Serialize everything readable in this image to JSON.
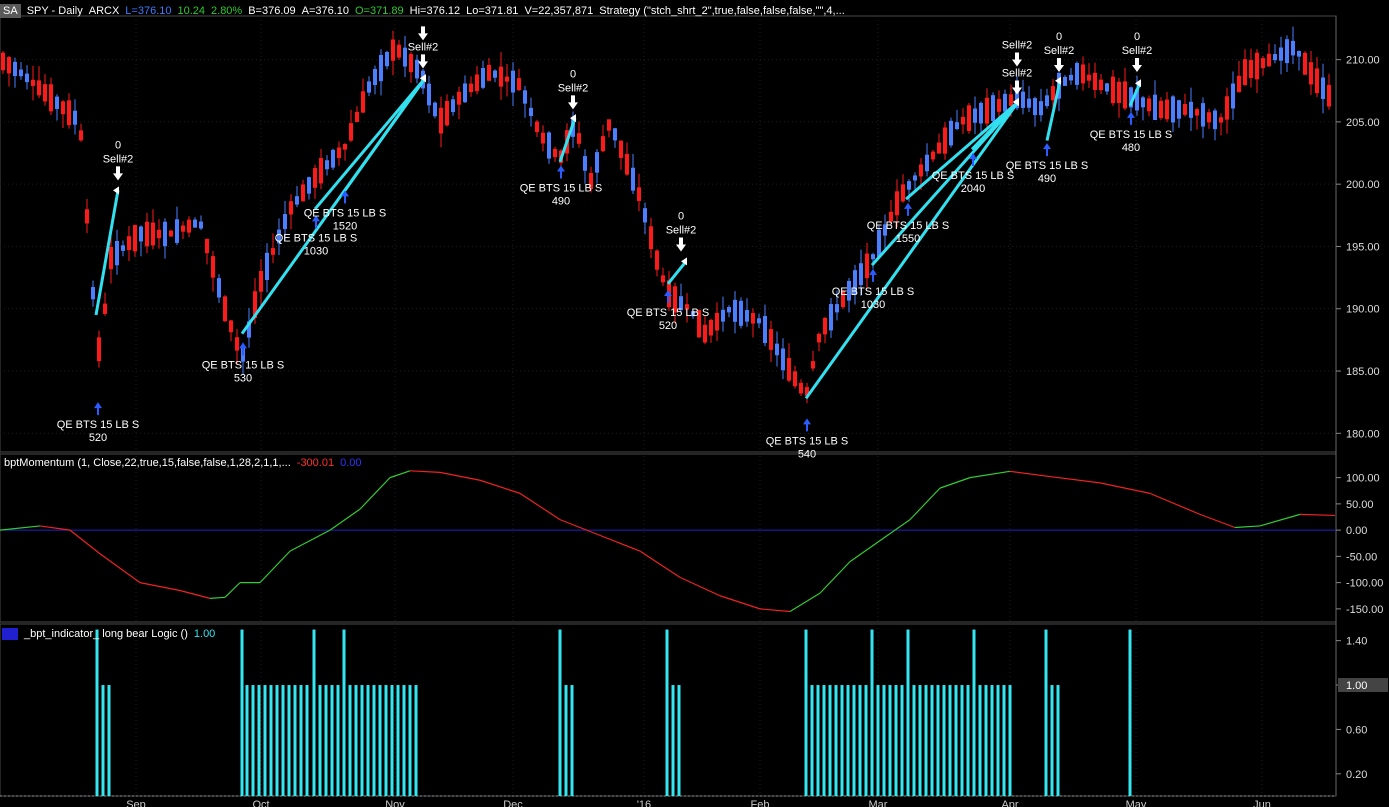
{
  "header": {
    "symbol_badge": "SA",
    "symbol": "SPY - Daily",
    "exchange": "ARCX",
    "last": "L=376.10",
    "change": "10.24",
    "change_pct": "2.80%",
    "bid": "B=376.09",
    "ask": "A=376.10",
    "open": "O=371.89",
    "high": "Hi=376.12",
    "low": "Lo=371.81",
    "volume": "V=22,357,871",
    "strategy": "Strategy (\"stch_shrt_2\",true,false,false,false,\"\",4,..."
  },
  "momentum_header": {
    "name": "bptMomentum (1, Close,22,true,15,false,false,1,28,2,1,1,...",
    "value1": "-300.01",
    "value2": "0.00"
  },
  "indicator_header": {
    "name": "_bpt_indicator_ long bear Logic ()",
    "value": "1.00"
  },
  "colors": {
    "up": "#4a7fff",
    "down": "#ff1a1a",
    "trend_line": "#33e0f0",
    "momentum_up": "#33cc33",
    "momentum_down": "#ee2222",
    "zero_line": "#2222cc",
    "bars": "#33e6f0",
    "grid": "#1e1e1e"
  },
  "chart_data": {
    "type": "candlestick",
    "price_axis": {
      "ticks": [
        "210.00",
        "205.00",
        "200.00",
        "195.00",
        "190.00",
        "185.00",
        "180.00"
      ],
      "range": [
        178.5,
        213.5
      ]
    },
    "momentum_axis": {
      "ticks": [
        "100.00",
        "50.00",
        "0.00",
        "-50.00",
        "-100.00",
        "-150.00"
      ],
      "range": [
        -175,
        145
      ]
    },
    "indicator_axis": {
      "ticks": [
        "1.40",
        "1.00",
        "0.60",
        "0.20"
      ],
      "highlight": "1.00",
      "range": [
        0,
        1.55
      ]
    },
    "x_ticks": [
      "Sep",
      "Oct",
      "Nov",
      "Dec",
      "'16",
      "Feb",
      "Mar",
      "Apr",
      "May",
      "Jun"
    ],
    "trade_lines": [
      {
        "points": [
          [
            96,
            189.5
          ],
          [
            118,
            199.5
          ]
        ]
      },
      {
        "points": [
          [
            242,
            188.0
          ],
          [
            425,
            208.5
          ]
        ]
      },
      {
        "points": [
          [
            315,
            198.0
          ],
          [
            425,
            208.5
          ]
        ]
      },
      {
        "points": [
          [
            345,
            199.5
          ],
          [
            425,
            208.5
          ]
        ]
      },
      {
        "points": [
          [
            560,
            201.8
          ],
          [
            575,
            205.3
          ]
        ]
      },
      {
        "points": [
          [
            668,
            192.0
          ],
          [
            686,
            193.8
          ]
        ]
      },
      {
        "points": [
          [
            806,
            182.8
          ],
          [
            1018,
            206.6
          ]
        ]
      },
      {
        "points": [
          [
            872,
            193.5
          ],
          [
            1018,
            206.6
          ]
        ]
      },
      {
        "points": [
          [
            906,
            198.8
          ],
          [
            1018,
            206.6
          ]
        ]
      },
      {
        "points": [
          [
            972,
            202.8
          ],
          [
            1018,
            206.6
          ]
        ]
      },
      {
        "points": [
          [
            1047,
            203.5
          ],
          [
            1060,
            208.3
          ]
        ]
      },
      {
        "points": [
          [
            1130,
            206.3
          ],
          [
            1140,
            208.1
          ]
        ]
      }
    ],
    "buy_labels": [
      {
        "x": 98,
        "price": 182.5,
        "text": "QE BTS 15 LB S",
        "qty": "520"
      },
      {
        "x": 243,
        "price": 187.3,
        "text": "QE BTS 15 LB S",
        "qty": "530"
      },
      {
        "x": 316,
        "price": 197.5,
        "text": "QE BTS 15 LB S",
        "qty": "1030"
      },
      {
        "x": 345,
        "price": 199.5,
        "text": "QE BTS 15 LB S",
        "qty": "1520"
      },
      {
        "x": 561,
        "price": 201.5,
        "text": "QE BTS 15 LB S",
        "qty": "490"
      },
      {
        "x": 668,
        "price": 191.5,
        "text": "QE BTS 15 LB S",
        "qty": "520"
      },
      {
        "x": 807,
        "price": 181.2,
        "text": "QE BTS 15 LB S",
        "qty": "540"
      },
      {
        "x": 873,
        "price": 193.2,
        "text": "QE BTS 15 LB S",
        "qty": "1030"
      },
      {
        "x": 908,
        "price": 198.5,
        "text": "QE BTS 15 LB S",
        "qty": "1550"
      },
      {
        "x": 973,
        "price": 202.5,
        "text": "QE BTS 15 LB S",
        "qty": "2040"
      },
      {
        "x": 1047,
        "price": 203.3,
        "text": "QE BTS 15 LB S",
        "qty": "490"
      },
      {
        "x": 1131,
        "price": 205.8,
        "text": "QE BTS 15 LB S",
        "qty": "480"
      }
    ],
    "sell_labels": [
      {
        "x": 118,
        "price": 200.3,
        "top": "0",
        "text": "Sell#2"
      },
      {
        "x": 423,
        "price": 209.3,
        "top": "",
        "text": "Sell#2"
      },
      {
        "x": 423,
        "price": 209.3,
        "top": "",
        "text": ""
      },
      {
        "x": 573,
        "price": 206.0,
        "top": "0",
        "text": "Sell#2"
      },
      {
        "x": 681,
        "price": 194.6,
        "top": "0",
        "text": "Sell#2"
      },
      {
        "x": 1017,
        "price": 207.2,
        "top": "",
        "text": "Sell#2"
      },
      {
        "x": 1017,
        "price": 207.2,
        "top": "",
        "text": "Sell#2"
      },
      {
        "x": 1059,
        "price": 209.0,
        "top": "0",
        "text": "Sell#2"
      },
      {
        "x": 1137,
        "price": 209.0,
        "top": "0",
        "text": "Sell#2"
      }
    ],
    "momentum_points": [
      [
        0,
        0
      ],
      [
        40,
        8
      ],
      [
        70,
        0
      ],
      [
        100,
        -45
      ],
      [
        140,
        -100
      ],
      [
        180,
        -115
      ],
      [
        210,
        -130
      ],
      [
        225,
        -128
      ],
      [
        240,
        -100
      ],
      [
        260,
        -100
      ],
      [
        290,
        -40
      ],
      [
        330,
        0
      ],
      [
        360,
        40
      ],
      [
        390,
        100
      ],
      [
        410,
        113
      ],
      [
        440,
        110
      ],
      [
        480,
        95
      ],
      [
        520,
        70
      ],
      [
        560,
        20
      ],
      [
        600,
        -10
      ],
      [
        640,
        -40
      ],
      [
        680,
        -90
      ],
      [
        720,
        -125
      ],
      [
        760,
        -150
      ],
      [
        790,
        -155
      ],
      [
        820,
        -120
      ],
      [
        850,
        -60
      ],
      [
        880,
        -20
      ],
      [
        910,
        20
      ],
      [
        940,
        80
      ],
      [
        970,
        100
      ],
      [
        1010,
        112
      ],
      [
        1050,
        102
      ],
      [
        1100,
        90
      ],
      [
        1150,
        70
      ],
      [
        1200,
        30
      ],
      [
        1235,
        5
      ],
      [
        1260,
        8
      ],
      [
        1300,
        30
      ],
      [
        1335,
        28
      ]
    ],
    "indicator_bars": [
      [
        97,
        1.5
      ],
      [
        103,
        1.0
      ],
      [
        109,
        1.0
      ],
      [
        242,
        1.5
      ],
      [
        247,
        1.0
      ],
      [
        253,
        1.0
      ],
      [
        259,
        1.0
      ],
      [
        265,
        1.0
      ],
      [
        271,
        1.0
      ],
      [
        277,
        1.0
      ],
      [
        283,
        1.0
      ],
      [
        289,
        1.0
      ],
      [
        295,
        1.0
      ],
      [
        301,
        1.0
      ],
      [
        307,
        1.0
      ],
      [
        314,
        1.5
      ],
      [
        320,
        1.0
      ],
      [
        326,
        1.0
      ],
      [
        332,
        1.0
      ],
      [
        338,
        1.0
      ],
      [
        344,
        1.5
      ],
      [
        350,
        1.0
      ],
      [
        356,
        1.0
      ],
      [
        362,
        1.0
      ],
      [
        368,
        1.0
      ],
      [
        374,
        1.0
      ],
      [
        380,
        1.0
      ],
      [
        386,
        1.0
      ],
      [
        392,
        1.0
      ],
      [
        398,
        1.0
      ],
      [
        404,
        1.0
      ],
      [
        410,
        1.0
      ],
      [
        416,
        1.0
      ],
      [
        560,
        1.5
      ],
      [
        566,
        1.0
      ],
      [
        572,
        1.0
      ],
      [
        667,
        1.5
      ],
      [
        673,
        1.0
      ],
      [
        679,
        1.0
      ],
      [
        806,
        1.5
      ],
      [
        812,
        1.0
      ],
      [
        818,
        1.0
      ],
      [
        824,
        1.0
      ],
      [
        830,
        1.0
      ],
      [
        836,
        1.0
      ],
      [
        842,
        1.0
      ],
      [
        848,
        1.0
      ],
      [
        854,
        1.0
      ],
      [
        860,
        1.0
      ],
      [
        866,
        1.0
      ],
      [
        872,
        1.5
      ],
      [
        878,
        1.0
      ],
      [
        884,
        1.0
      ],
      [
        890,
        1.0
      ],
      [
        896,
        1.0
      ],
      [
        902,
        1.0
      ],
      [
        908,
        1.5
      ],
      [
        914,
        1.0
      ],
      [
        920,
        1.0
      ],
      [
        926,
        1.0
      ],
      [
        932,
        1.0
      ],
      [
        938,
        1.0
      ],
      [
        944,
        1.0
      ],
      [
        950,
        1.0
      ],
      [
        956,
        1.0
      ],
      [
        962,
        1.0
      ],
      [
        968,
        1.0
      ],
      [
        974,
        1.5
      ],
      [
        980,
        1.0
      ],
      [
        986,
        1.0
      ],
      [
        992,
        1.0
      ],
      [
        998,
        1.0
      ],
      [
        1004,
        1.0
      ],
      [
        1010,
        1.0
      ],
      [
        1046,
        1.5
      ],
      [
        1052,
        1.0
      ],
      [
        1058,
        1.0
      ],
      [
        1130,
        1.5
      ]
    ]
  }
}
